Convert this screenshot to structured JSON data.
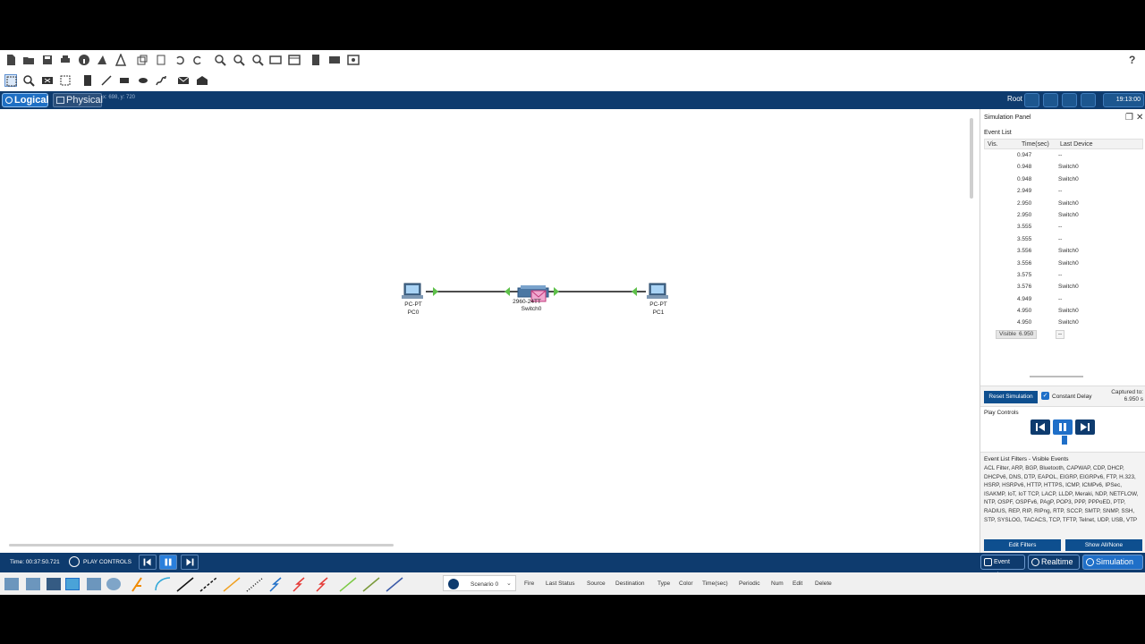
{
  "toolbar": {
    "help": "?"
  },
  "mode_bar": {
    "logical_tab": "Logical",
    "physical_tab": "Physical",
    "coords": "x: 698, y: 720",
    "root_label": "Root",
    "clock": "19:13:00"
  },
  "topology": {
    "devices": [
      {
        "type_label": "PC-PT",
        "name": "PC0"
      },
      {
        "type_label": "2960-24TT",
        "name": "Switch0"
      },
      {
        "type_label": "PC-PT",
        "name": "PC1"
      }
    ]
  },
  "simulation_panel": {
    "title": "Simulation Panel",
    "event_list_title": "Event List",
    "columns": {
      "vis": "Vis.",
      "time": "Time(sec)",
      "device": "Last Device"
    },
    "events": [
      {
        "time": "0.947",
        "device": "--"
      },
      {
        "time": "0.948",
        "device": "Switch0"
      },
      {
        "time": "0.948",
        "device": "Switch0"
      },
      {
        "time": "2.949",
        "device": "--"
      },
      {
        "time": "2.950",
        "device": "Switch0"
      },
      {
        "time": "2.950",
        "device": "Switch0"
      },
      {
        "time": "3.555",
        "device": "--"
      },
      {
        "time": "3.555",
        "device": "--"
      },
      {
        "time": "3.556",
        "device": "Switch0"
      },
      {
        "time": "3.556",
        "device": "Switch0"
      },
      {
        "time": "3.575",
        "device": "--"
      },
      {
        "time": "3.576",
        "device": "Switch0"
      },
      {
        "time": "4.949",
        "device": "--"
      },
      {
        "time": "4.950",
        "device": "Switch0"
      },
      {
        "time": "4.950",
        "device": "Switch0"
      }
    ],
    "current_event": {
      "vis": "Visible",
      "time": "6.950",
      "device": "--"
    },
    "reset_button": "Reset Simulation",
    "constant_delay": "Constant Delay",
    "captured_to_label": "Captured to:",
    "captured_to_value": "6.950 s",
    "play_controls_title": "Play Controls",
    "filters_title": "Event List Filters - Visible Events",
    "filters_text": "ACL Filter, ARP, BGP, Bluetooth, CAPWAP, CDP, DHCP, DHCPv6, DNS, DTP, EAPOL, EIGRP, EIGRPv6, FTP, H.323, HSRP, HSRPv6, HTTP, HTTPS, ICMP, ICMPv6, IPSec, ISAKMP, IoT, IoT TCP, LACP, LLDP, Meraki, NDP, NETFLOW, NTP, OSPF, OSPFv6, PAgP, POP3, PPP, PPPoED, PTP, RADIUS, REP, RIP, RIPng, RTP, SCCP, SMTP, SNMP, SSH, STP, SYSLOG, TACACS, TCP, TFTP, Telnet, UDP, USB, VTP",
    "edit_filters": "Edit Filters",
    "show_all": "Show All/None"
  },
  "bottom_bar": {
    "time": "Time: 00:37:50.721",
    "play_controls": "PLAY CONTROLS",
    "event_list_btn": "Event List",
    "realtime_btn": "Realtime",
    "simulation_btn": "Simulation"
  },
  "pdu_table": {
    "scenario": "Scenario 0",
    "columns": [
      "Fire",
      "Last Status",
      "Source",
      "Destination",
      "Type",
      "Color",
      "Time(sec)",
      "Periodic",
      "Num",
      "Edit",
      "Delete"
    ]
  }
}
